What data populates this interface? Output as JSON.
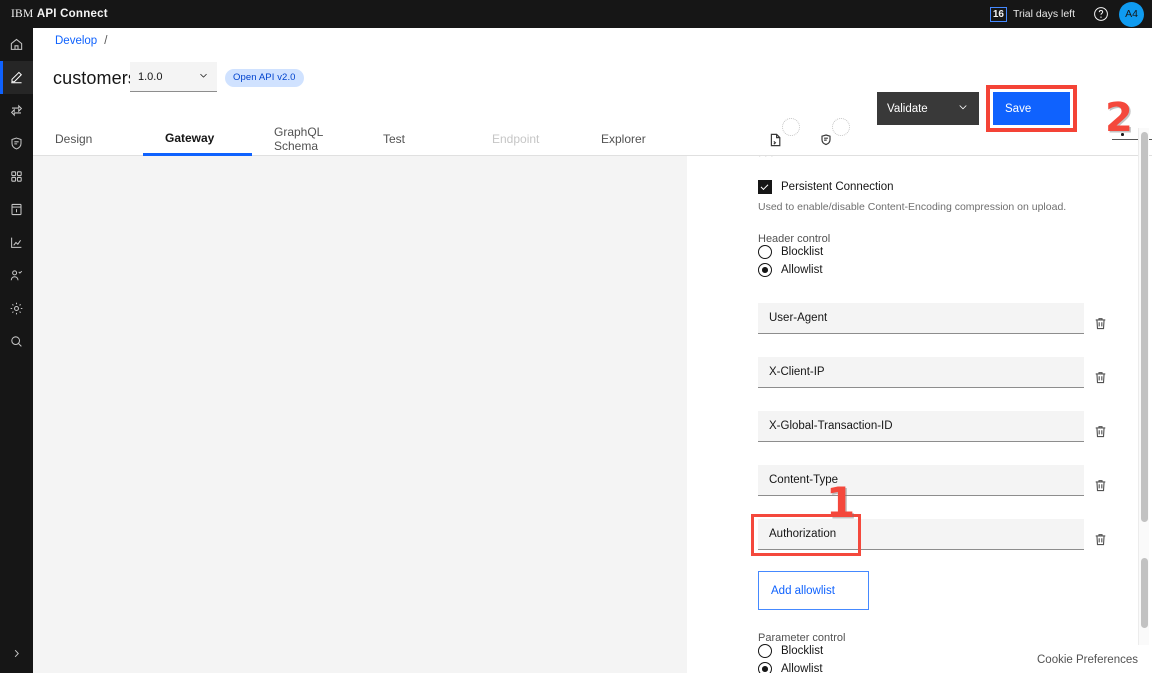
{
  "topbar": {
    "brand_light": "IBM",
    "brand_bold": "API Connect",
    "trial_days": "16",
    "trial_label": "Trial days left",
    "help_icon": "help-circle-icon",
    "avatar_initials": "A4"
  },
  "sidebar": {
    "items": [
      {
        "name": "home",
        "icon": "home-icon"
      },
      {
        "name": "develop",
        "icon": "pencil-icon",
        "active": true
      },
      {
        "name": "publish",
        "icon": "deploy-icon"
      },
      {
        "name": "manage",
        "icon": "shield-chat-icon"
      },
      {
        "name": "apps",
        "icon": "grid-icon"
      },
      {
        "name": "catalog",
        "icon": "catalog-icon"
      },
      {
        "name": "analytics",
        "icon": "analytics-icon"
      },
      {
        "name": "members",
        "icon": "users-icon"
      },
      {
        "name": "settings",
        "icon": "gear-icon"
      },
      {
        "name": "search",
        "icon": "search-icon"
      }
    ],
    "expand_icon": "chevron-right-icon"
  },
  "breadcrumb": {
    "develop": "Develop",
    "separator": "/"
  },
  "header": {
    "api_title": "customers",
    "version": "1.0.0",
    "version_chevron": "chevron-down-icon",
    "openapi_badge": "Open API v2.0",
    "source_icon": "document-source-icon",
    "comment_icon": "shield-comment-icon",
    "validate_label": "Validate",
    "validate_chevron": "chevron-down-icon",
    "save_label": "Save"
  },
  "tabs": [
    {
      "label": "Design",
      "active": false,
      "disabled": false
    },
    {
      "label": "Gateway",
      "active": true,
      "disabled": false
    },
    {
      "label": "GraphQL Schema",
      "active": false,
      "disabled": false
    },
    {
      "label": "Test",
      "active": false,
      "disabled": false
    },
    {
      "label": "Endpoint",
      "active": false,
      "disabled": true
    },
    {
      "label": "Explorer",
      "active": false,
      "disabled": false
    }
  ],
  "panel": {
    "persistent_connection": {
      "label": "Persistent Connection",
      "checked": true,
      "helper": "Used to enable/disable Content-Encoding compression on upload."
    },
    "header_control": {
      "label": "Header control",
      "options": [
        {
          "label": "Blocklist",
          "selected": false
        },
        {
          "label": "Allowlist",
          "selected": true
        }
      ]
    },
    "header_fields": [
      {
        "value": "User-Agent",
        "delete_icon": "trash-icon"
      },
      {
        "value": "X-Client-IP",
        "delete_icon": "trash-icon"
      },
      {
        "value": "X-Global-Transaction-ID",
        "delete_icon": "trash-icon"
      },
      {
        "value": "Content-Type",
        "delete_icon": "trash-icon"
      },
      {
        "value": "Authorization",
        "delete_icon": "trash-icon"
      }
    ],
    "add_allowlist_label": "Add allowlist",
    "parameter_control": {
      "label": "Parameter control",
      "options": [
        {
          "label": "Blocklist",
          "selected": false
        },
        {
          "label": "Allowlist",
          "selected": true
        }
      ]
    }
  },
  "annotations": {
    "marker_one": "1",
    "marker_two": "2",
    "color": "#f4483c"
  },
  "footer": {
    "cookie_preferences": "Cookie Preferences"
  }
}
